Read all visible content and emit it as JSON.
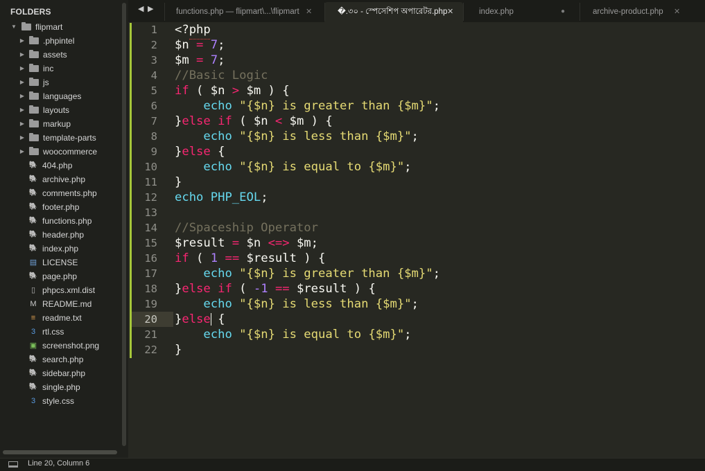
{
  "sidebar": {
    "title": "FOLDERS",
    "root": {
      "name": "flipmart",
      "expanded": true
    },
    "folders": [
      ".phpintel",
      "assets",
      "inc",
      "js",
      "languages",
      "layouts",
      "markup",
      "template-parts",
      "woocommerce"
    ],
    "files": [
      {
        "name": "404.php",
        "icon": "php-icon"
      },
      {
        "name": "archive.php",
        "icon": "php-icon"
      },
      {
        "name": "comments.php",
        "icon": "php-icon"
      },
      {
        "name": "footer.php",
        "icon": "php-icon"
      },
      {
        "name": "functions.php",
        "icon": "php-icon"
      },
      {
        "name": "header.php",
        "icon": "php-icon"
      },
      {
        "name": "index.php",
        "icon": "php-icon"
      },
      {
        "name": "LICENSE",
        "icon": "license-icon"
      },
      {
        "name": "page.php",
        "icon": "php-icon"
      },
      {
        "name": "phpcs.xml.dist",
        "icon": "file-icon"
      },
      {
        "name": "README.md",
        "icon": "markdown-icon"
      },
      {
        "name": "readme.txt",
        "icon": "text-file-icon"
      },
      {
        "name": "rtl.css",
        "icon": "css-icon"
      },
      {
        "name": "screenshot.png",
        "icon": "image-icon"
      },
      {
        "name": "search.php",
        "icon": "php-icon"
      },
      {
        "name": "sidebar.php",
        "icon": "php-icon"
      },
      {
        "name": "single.php",
        "icon": "php-icon"
      },
      {
        "name": "style.css",
        "icon": "css-icon"
      }
    ]
  },
  "tabs": [
    {
      "label": "functions.php — flipmart\\...\\flipmart",
      "state": "close",
      "active": false
    },
    {
      "label": "�.৩০ - স্পেসেশিপ অপারেটর.php",
      "state": "close",
      "active": true
    },
    {
      "label": "index.php",
      "state": "modified",
      "active": false
    },
    {
      "label": "archive-product.php",
      "state": "close",
      "active": false
    }
  ],
  "tab_nav": {
    "left": "◀",
    "right": "▶"
  },
  "editor": {
    "current_line": 20,
    "lines": [
      "<?php",
      "$n = 7;",
      "$m = 7;",
      "//Basic Logic",
      "if ( $n > $m ) {",
      "    echo \"{$n} is greater than {$m}\";",
      "}else if ( $n < $m ) {",
      "    echo \"{$n} is less than {$m}\";",
      "}else {",
      "    echo \"{$n} is equal to {$m}\";",
      "}",
      "echo PHP_EOL;",
      "",
      "//Spaceship Operator",
      "$result = $n <=> $m;",
      "if ( 1 == $result ) {",
      "    echo \"{$n} is greater than {$m}\";",
      "}else if ( -1 == $result ) {",
      "    echo \"{$n} is less than {$m}\";",
      "}else {",
      "    echo \"{$n} is equal to {$m}\";",
      "}"
    ]
  },
  "statusbar": {
    "text": "Line 20, Column 6"
  },
  "colors": {
    "background": "#272822",
    "keyword": "#f92672",
    "function": "#66d9ef",
    "string": "#e6db74",
    "number": "#ae81ff",
    "comment": "#75715e",
    "gutter_marker": "#a6c73a"
  }
}
